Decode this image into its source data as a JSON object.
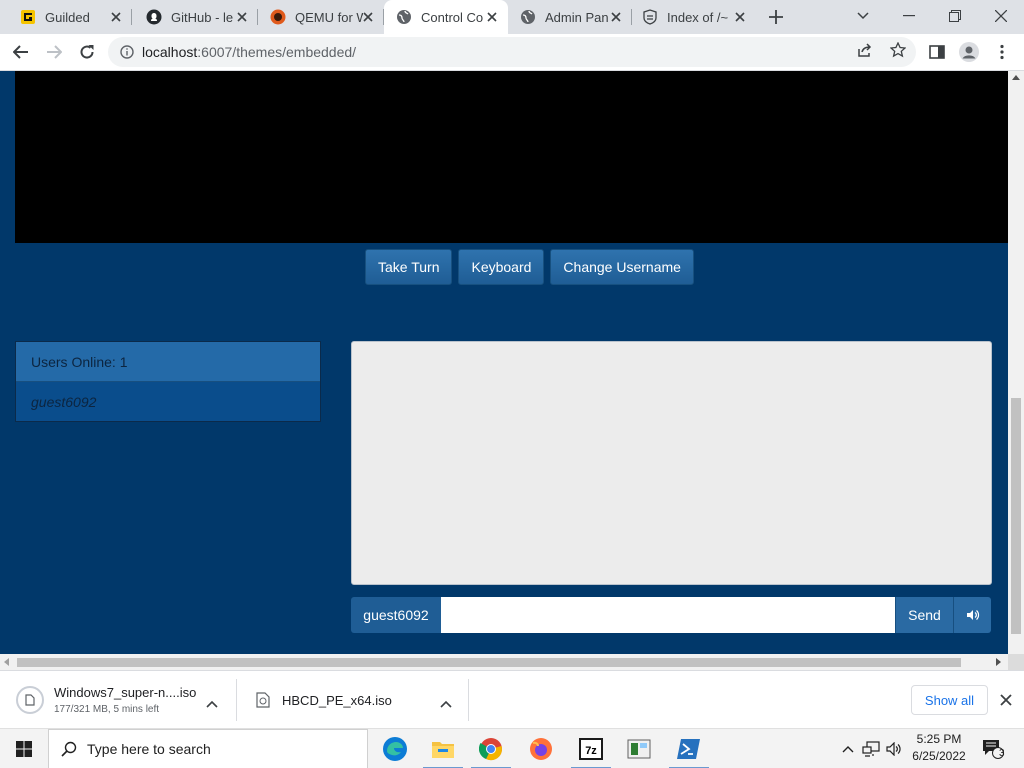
{
  "tabs": [
    {
      "title": "Guilded",
      "favicon": "guilded-icon"
    },
    {
      "title": "GitHub - le",
      "favicon": "github-icon"
    },
    {
      "title": "QEMU for W",
      "favicon": "qemu-icon"
    },
    {
      "title": "Control Co",
      "favicon": "globe-icon",
      "active": true
    },
    {
      "title": "Admin Pan",
      "favicon": "globe-icon"
    },
    {
      "title": "Index of /~",
      "favicon": "folder-icon"
    }
  ],
  "address": {
    "host": "localhost",
    "path": ":6007/themes/embedded/"
  },
  "controls": {
    "take_turn": "Take Turn",
    "keyboard": "Keyboard",
    "change_username": "Change Username"
  },
  "users": {
    "header": "Users Online: 1",
    "list": [
      "guest6092"
    ]
  },
  "chat": {
    "username": "guest6092",
    "input_value": "",
    "send_label": "Send"
  },
  "downloads": [
    {
      "name": "Windows7_super-n....iso",
      "status": "177/321 MB, 5 mins left"
    },
    {
      "name": "HBCD_PE_x64.iso",
      "status": ""
    }
  ],
  "downloads_show_all": "Show all",
  "taskbar": {
    "search_placeholder": "Type here to search",
    "time": "5:25 PM",
    "date": "6/25/2022",
    "notification_count": "3"
  },
  "colors": {
    "page_bg": "#01386a",
    "button_bg": "#2a6aa3",
    "chat_bg": "#ececec",
    "link_blue": "#1a73e8"
  }
}
